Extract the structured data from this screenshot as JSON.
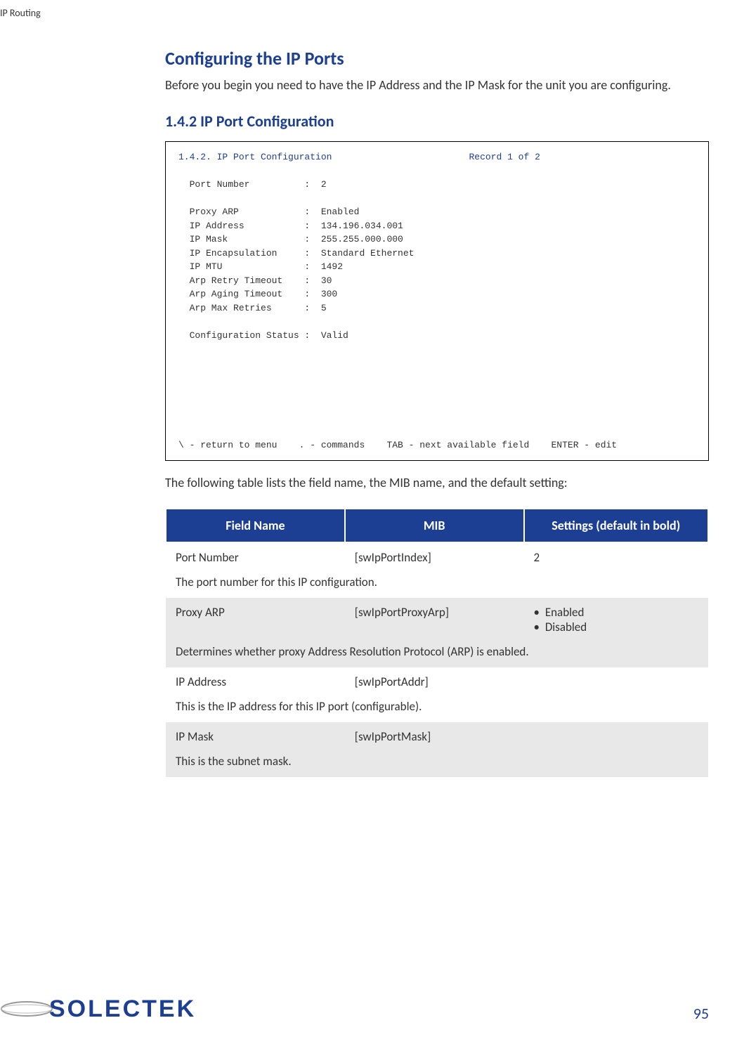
{
  "header": "IP Routing",
  "main": {
    "title": "Configuring the IP Ports",
    "intro": "Before you begin you need to have the IP Address and the IP Mask for the unit you are configuring.",
    "section_title": "1.4.2 IP Port Configuration",
    "terminal": {
      "title_line": "1.4.2. IP Port Configuration                         Record 1 of 2",
      "body": "  Port Number          :  2\n\n  Proxy ARP            :  Enabled\n  IP Address           :  134.196.034.001\n  IP Mask              :  255.255.000.000\n  IP Encapsulation     :  Standard Ethernet\n  IP MTU               :  1492\n  Arp Retry Timeout    :  30\n  Arp Aging Timeout    :  300\n  Arp Max Retries      :  5\n\n  Configuration Status :  Valid\n\n\n\n\n\n\n\n\\ - return to menu    . - commands    TAB - next available field    ENTER - edit"
    },
    "table_intro": "The following table lists the field name, the MIB name, and the default setting:",
    "table": {
      "headers": [
        "Field Name",
        "MIB",
        "Settings (default in bold)"
      ],
      "rows": [
        {
          "bg": "white",
          "field": "Port Number",
          "mib": "[swIpPortIndex]",
          "settings_text": "2",
          "settings_list": null,
          "desc": "The port number for this IP configuration."
        },
        {
          "bg": "gray",
          "field": "Proxy ARP",
          "mib": "[swIpPortProxyArp]",
          "settings_text": null,
          "settings_list": [
            "Enabled",
            "Disabled"
          ],
          "desc": "Determines whether proxy Address Resolution Protocol (ARP) is enabled."
        },
        {
          "bg": "white",
          "field": "IP Address",
          "mib": "[swIpPortAddr]",
          "settings_text": "",
          "settings_list": null,
          "desc": "This is the IP address for this IP port (configurable)."
        },
        {
          "bg": "gray",
          "field": "IP Mask",
          "mib": "[swIpPortMask]",
          "settings_text": "",
          "settings_list": null,
          "desc": "This is the subnet mask."
        }
      ]
    }
  },
  "footer": {
    "logo_text": "SOLECTEK",
    "page_number": "95"
  }
}
